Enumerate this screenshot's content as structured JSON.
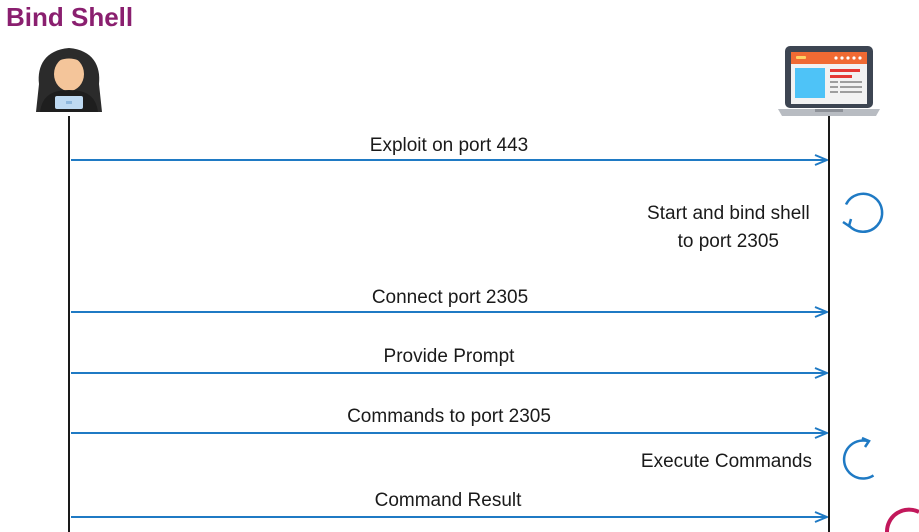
{
  "title": "Bind Shell",
  "colors": {
    "title": "#8a1f6f",
    "arrow": "#1f7ac4",
    "lifeline": "#1a1a1a",
    "text": "#1a1a1a",
    "corner_accent": "#c2185b"
  },
  "participants": {
    "attacker": {
      "icon": "hacker-icon"
    },
    "target": {
      "icon": "laptop-icon"
    }
  },
  "messages": [
    {
      "label": "Exploit on port 443",
      "direction": "to-target"
    },
    {
      "label": "Connect port 2305",
      "direction": "to-target"
    },
    {
      "label": "Provide Prompt",
      "direction": "to-attacker"
    },
    {
      "label": "Commands to port 2305",
      "direction": "to-target"
    },
    {
      "label": "Command Result",
      "direction": "to-attacker"
    }
  ],
  "self_actions": [
    {
      "lines": [
        "Start and bind shell",
        "to port 2305"
      ],
      "icon": "loop-icon"
    },
    {
      "lines": [
        "Execute Commands"
      ],
      "icon": "loop-icon"
    }
  ]
}
